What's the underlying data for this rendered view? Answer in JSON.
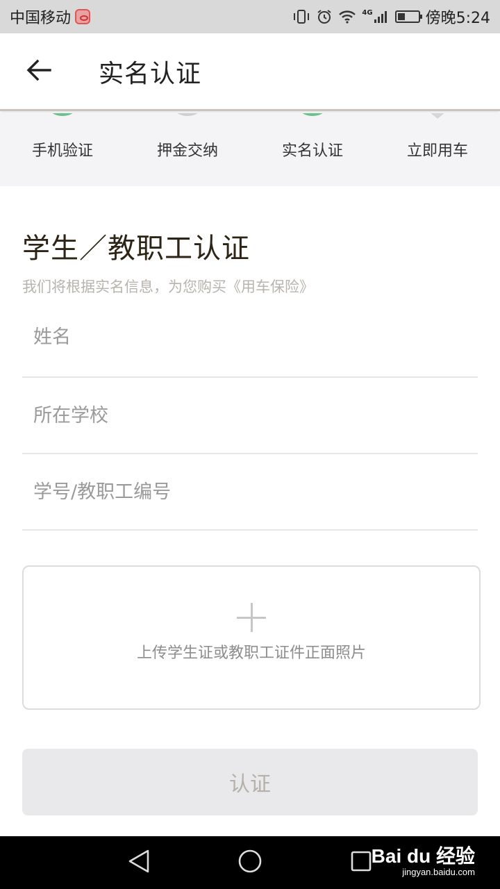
{
  "status_bar": {
    "carrier": "中国移动",
    "network_tag": "4G",
    "time": "傍晚5:24"
  },
  "header": {
    "title": "实名认证",
    "back_icon": "arrow-left-icon"
  },
  "steps": [
    {
      "label": "手机验证",
      "state": "done"
    },
    {
      "label": "押金交纳",
      "state": "pending"
    },
    {
      "label": "实名认证",
      "state": "current"
    },
    {
      "label": "立即用车",
      "state": "upcoming"
    }
  ],
  "section": {
    "title": "学生／教职工认证",
    "subtitle": "我们将根据实名信息，为您购买《用车保险》"
  },
  "form": {
    "name_placeholder": "姓名",
    "school_placeholder": "所在学校",
    "id_placeholder": "学号/教职工编号"
  },
  "upload": {
    "label": "上传学生证或教职工证件正面照片",
    "icon": "plus-icon"
  },
  "submit": {
    "label": "认证"
  },
  "watermark": {
    "main": "Bai du 经验",
    "sub": "jingyan.baidu.com"
  },
  "colors": {
    "step_done": "#6cc08b",
    "step_pending": "#cfcfcf",
    "title_text": "#2d2416",
    "disabled_button_bg": "#e9e9eb",
    "disabled_button_text": "#b5b0a8"
  }
}
